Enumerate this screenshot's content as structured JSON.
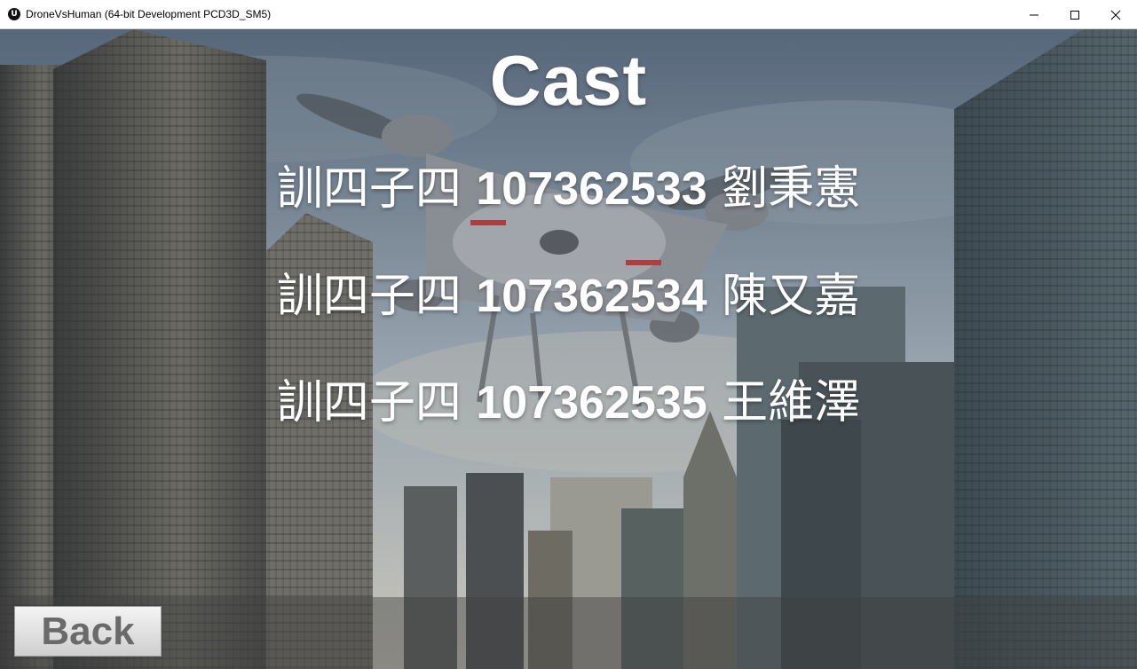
{
  "window": {
    "app_icon": "unreal-engine-icon",
    "title": "DroneVsHuman (64-bit Development PCD3D_SM5)",
    "minimize_icon": "minimize-icon",
    "maximize_icon": "maximize-icon",
    "close_icon": "close-icon"
  },
  "scene": {
    "title": "Cast",
    "cast": [
      {
        "prefix": "訓四子四",
        "id": "107362533",
        "name": "劉秉憲"
      },
      {
        "prefix": "訓四子四",
        "id": "107362534",
        "name": "陳又嘉"
      },
      {
        "prefix": "訓四子四",
        "id": "107362535",
        "name": "王維澤"
      }
    ],
    "back_label": "Back"
  },
  "colors": {
    "sky_top": "#5f6f80",
    "sky_bottom": "#b4bcc2",
    "text": "#ffffff",
    "button_text": "#6a6a6a"
  }
}
